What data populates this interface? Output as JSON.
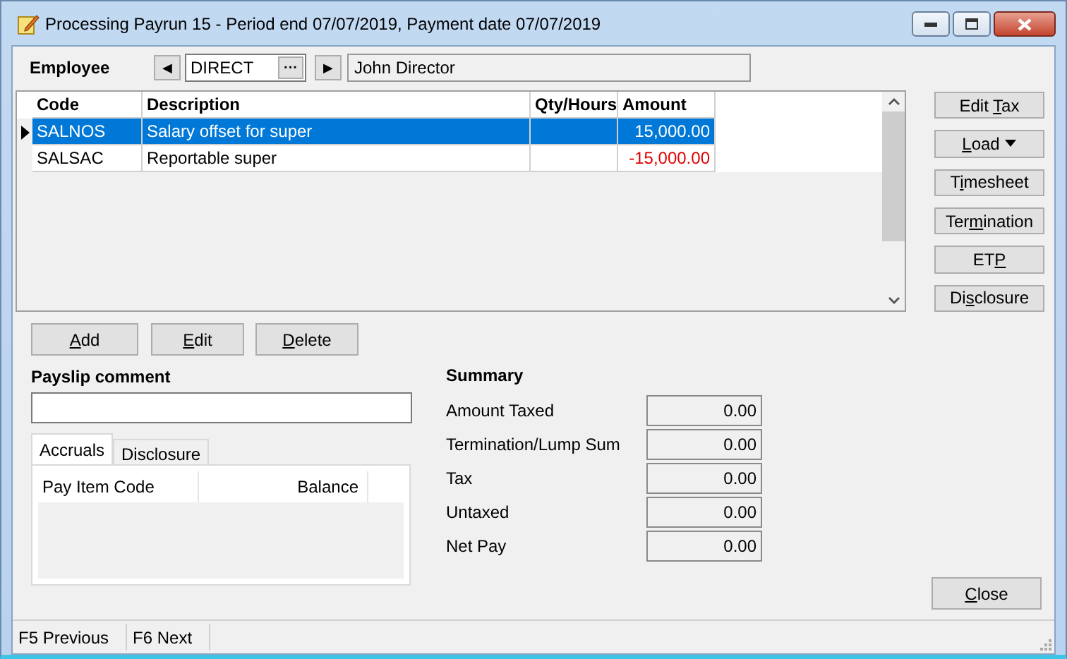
{
  "window": {
    "title": "Processing Payrun 15 - Period end 07/07/2019, Payment date 07/07/2019"
  },
  "employee": {
    "label": "Employee",
    "code": "DIRECT",
    "lookup": "···",
    "name": "John Director",
    "prev": "◀",
    "next": "▶"
  },
  "table": {
    "columns": [
      "Code",
      "Description",
      "Qty/Hours",
      "Amount"
    ],
    "rows": [
      {
        "code": "SALNOS",
        "description": "Salary offset for super",
        "qty": "",
        "amount": "15,000.00",
        "negative": false,
        "selected": true
      },
      {
        "code": "SALSAC",
        "description": "Reportable super",
        "qty": "",
        "amount": "-15,000.00",
        "negative": true,
        "selected": false
      }
    ]
  },
  "side_buttons": [
    {
      "before": "Edit ",
      "key": "T",
      "after": "ax",
      "dropdown": false
    },
    {
      "key": "L",
      "after": "oad",
      "dropdown": true
    },
    {
      "before": "T",
      "key": "i",
      "after": "mesheet",
      "dropdown": false
    },
    {
      "before": "Ter",
      "key": "m",
      "after": "ination",
      "dropdown": false
    },
    {
      "before": "ET",
      "key": "P",
      "dropdown": false
    },
    {
      "before": "Di",
      "key": "s",
      "after": "closure",
      "dropdown": false
    }
  ],
  "row_buttons": [
    {
      "key": "A",
      "after": "dd"
    },
    {
      "key": "E",
      "after": "dit"
    },
    {
      "key": "D",
      "after": "elete"
    }
  ],
  "payslip_comment": {
    "label": "Payslip comment"
  },
  "tabs": [
    {
      "label": "Accruals",
      "selected": true
    },
    {
      "label": "Disclosure",
      "selected": false
    }
  ],
  "accruals": {
    "columns": [
      "Pay Item Code",
      "Balance"
    ]
  },
  "summary": {
    "title": "Summary",
    "rows": [
      {
        "label": "Amount Taxed",
        "value": "0.00"
      },
      {
        "label": "Termination/Lump Sum",
        "value": "0.00"
      },
      {
        "label": "Tax",
        "value": "0.00"
      },
      {
        "label": "Untaxed",
        "value": "0.00"
      },
      {
        "label": "Net Pay",
        "value": "0.00"
      }
    ]
  },
  "close_button": {
    "key": "C",
    "after": "lose"
  },
  "status_bar": [
    "F5 Previous",
    "F6 Next"
  ]
}
